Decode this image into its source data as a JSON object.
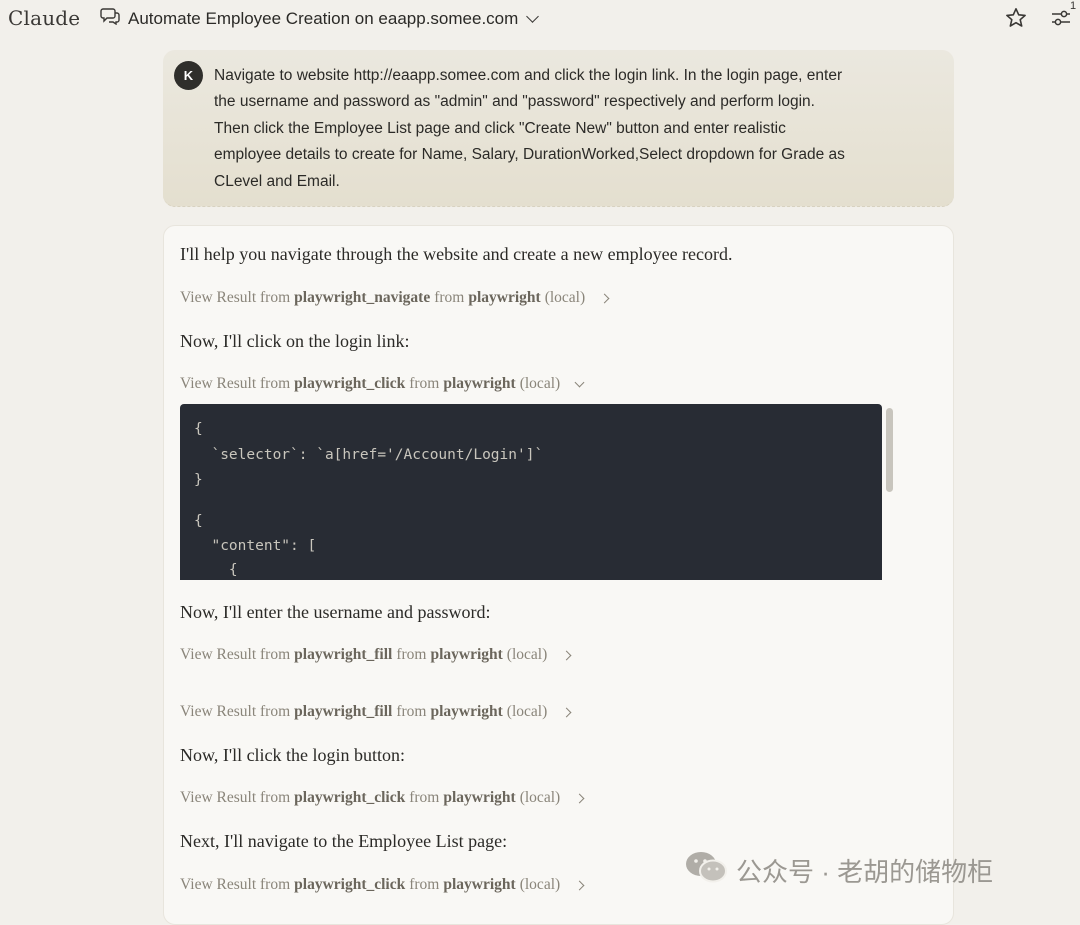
{
  "app": {
    "brand": "Claude"
  },
  "header": {
    "conversation_title": "Automate Employee Creation on eaapp.somee.com",
    "settings_badge": "1"
  },
  "user_message": {
    "avatar_initial": "K",
    "lines": [
      "Navigate to website http://eaapp.somee.com and click the login link. In the login page, enter",
      "the username and password as \"admin\" and \"password\" respectively and perform login.",
      "Then click the Employee List page and click \"Create New\" button and enter realistic",
      "employee details to create for Name, Salary, DurationWorked,Select dropdown for Grade as",
      "CLevel and Email."
    ]
  },
  "response": {
    "intro": "I'll help you navigate through the website and create a new employee record.",
    "result_prefix": "View Result from",
    "result_mid": "from",
    "result_suffix": "(local)",
    "server": "playwright",
    "results": {
      "r1": "playwright_navigate",
      "r2": "playwright_click",
      "r3": "playwright_fill",
      "r4": "playwright_fill",
      "r5": "playwright_click",
      "r6": "playwright_click"
    },
    "step_login_link": "Now, I'll click on the login link:",
    "step_credentials": "Now, I'll enter the username and password:",
    "step_login_button": "Now, I'll click the login button:",
    "step_employee_list": "Next, I'll navigate to the Employee List page:",
    "code_lines": [
      "{",
      "  `selector`: `a[href='/Account/Login']`",
      "}",
      "{",
      "  \"content\": [",
      "    {"
    ]
  },
  "watermark": {
    "text": "公众号 · 老胡的储物柜"
  }
}
